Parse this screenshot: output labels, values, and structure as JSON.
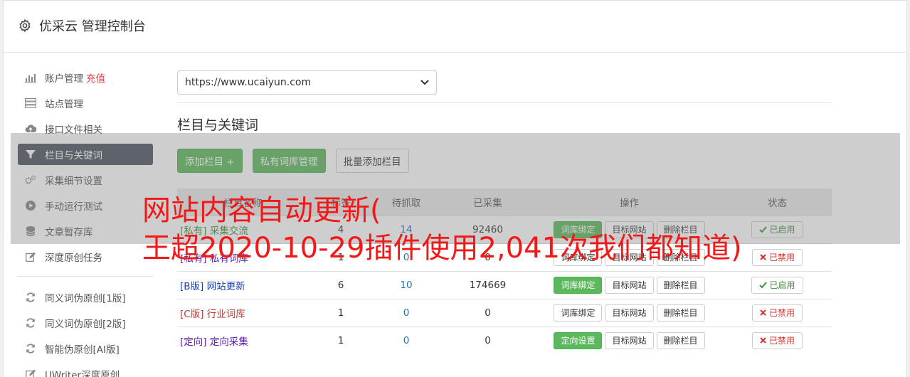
{
  "app": {
    "title": "优采云 管理控制台",
    "icon": "gear-icon"
  },
  "sidebar": {
    "items": [
      {
        "label": "账户管理",
        "extra": "充值",
        "icon": "bar-chart-icon"
      },
      {
        "label": "站点管理",
        "icon": "server-icon"
      },
      {
        "label": "接口文件相关",
        "icon": "cloud-upload-icon"
      },
      {
        "label": "栏目与关键词",
        "icon": "filter-icon",
        "active": true
      },
      {
        "label": "采集细节设置",
        "icon": "cogs-icon"
      },
      {
        "label": "手动运行测试",
        "icon": "play-circle-icon"
      },
      {
        "label": "文章暂存库",
        "icon": "database-icon"
      },
      {
        "label": "深度原创任务",
        "icon": "edit-icon"
      }
    ],
    "items2": [
      {
        "label": "同义词伪原创[1版]",
        "icon": "refresh-icon"
      },
      {
        "label": "同义词伪原创[2版]",
        "icon": "refresh-icon"
      },
      {
        "label": "智能伪原创[AI版]",
        "icon": "refresh-icon"
      },
      {
        "label": "UWriter深度原创",
        "icon": "edit-icon"
      }
    ]
  },
  "main": {
    "site_select": "https://www.ucaiyun.com",
    "section_title": "栏目与关键词",
    "buttons": {
      "add": "添加栏目 +",
      "private_lib": "私有词库管理",
      "batch_add": "批量添加栏目"
    }
  },
  "table": {
    "headers": [
      "栏目名称",
      "待抓取",
      "已采集",
      "操作",
      "状态"
    ],
    "headers_raw": [
      "栏目名称",
      "标签",
      "待抓取",
      "已采集",
      "操作",
      "状态"
    ],
    "rows": [
      {
        "tag": "[私有]",
        "name": "采集交流",
        "col2": "4",
        "pending": "14",
        "collected": "92460",
        "op1": "词库绑定",
        "op1_green": true,
        "op2": "目标网站",
        "op3": "删除栏目",
        "status": "已启用",
        "enabled": true,
        "color": "green"
      },
      {
        "tag": "[私有]",
        "name": "私有词库",
        "col2": "1",
        "pending": "0",
        "collected": "0",
        "op1": "词库绑定",
        "op1_green": false,
        "op2": "目标网站",
        "op3": "删除栏目",
        "status": "已禁用",
        "enabled": false,
        "color": "purple"
      },
      {
        "tag": "[B版]",
        "name": "网站更新",
        "col2": "6",
        "pending": "10",
        "collected": "174669",
        "op1": "词库绑定",
        "op1_green": true,
        "op2": "目标网站",
        "op3": "删除栏目",
        "status": "已启用",
        "enabled": true,
        "color": "blue"
      },
      {
        "tag": "[C版]",
        "name": "行业词库",
        "col2": "1",
        "pending": "0",
        "collected": "0",
        "op1": "词库绑定",
        "op1_green": false,
        "op2": "目标网站",
        "op3": "删除栏目",
        "status": "已禁用",
        "enabled": false,
        "color": "red"
      },
      {
        "tag": "[定向]",
        "name": "定向采集",
        "col2": "1",
        "pending": "0",
        "collected": "0",
        "op1": "定向设置",
        "op1_green": true,
        "op2": "目标网站",
        "op3": "删除栏目",
        "status": "已禁用",
        "enabled": false,
        "color": "purple"
      }
    ]
  },
  "watermark": {
    "line1": "网站内容自动更新(",
    "line2": "王超2020-10-29插件使用2,041次我们都知道)"
  },
  "colors": {
    "primary_green": "#5cb85c",
    "sidebar_active": "#4a5260",
    "recharge_red": "#e4393c",
    "watermark_red": "#f21818"
  }
}
